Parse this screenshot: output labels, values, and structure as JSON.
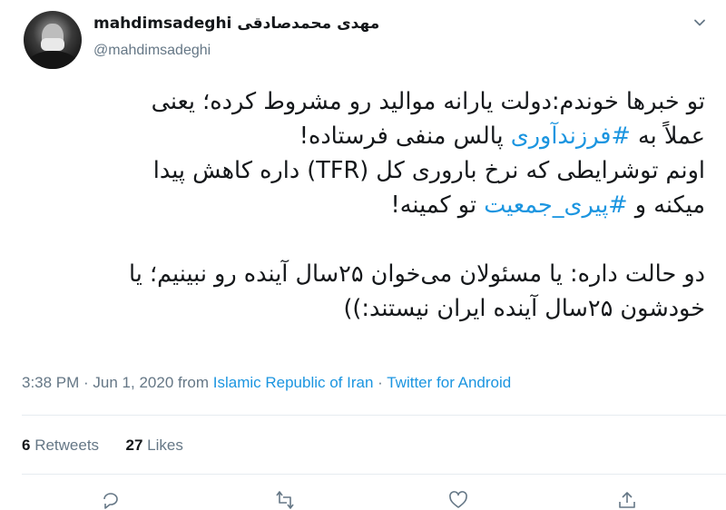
{
  "user": {
    "display_name": "mahdimsadeghi مهدی محمدصادقی",
    "handle": "@mahdimsadeghi"
  },
  "tweet": {
    "lines": [
      [
        {
          "text": "تو خبرها خوندم:دولت یارانه موالید رو مشروط کرده؛ یعنی"
        }
      ],
      [
        {
          "text": "عملاً به "
        },
        {
          "text": "#فرزندآوری",
          "hashtag": true
        },
        {
          "text": " پالس منفی فرستاده!"
        }
      ],
      [
        {
          "text": "اونم توشرایطی که نرخ باروری کل (TFR) داره کاهش پیدا"
        }
      ],
      [
        {
          "text": "میکنه و "
        },
        {
          "text": "#پیری_جمعیت",
          "hashtag": true
        },
        {
          "text": " تو کمینه!"
        }
      ],
      [],
      [
        {
          "text": "دو حالت داره: یا مسئولان می‌خوان ۲۵سال آینده رو نبینیم؛ یا"
        }
      ],
      [
        {
          "text": "خودشون ۲۵سال آینده ایران نیستند:))"
        }
      ]
    ]
  },
  "meta": {
    "time": "3:38 PM",
    "separator1": " · ",
    "date": "Jun 1, 2020",
    "from_label": " from ",
    "location": "Islamic Republic of Iran",
    "separator2": " · ",
    "source": "Twitter for Android"
  },
  "stats": {
    "retweets_count": "6",
    "retweets_label": " Retweets",
    "likes_count": "27",
    "likes_label": " Likes"
  },
  "icons": {
    "caret": "chevron-down-icon",
    "reply": "reply-icon",
    "retweet": "retweet-icon",
    "like": "heart-icon",
    "share": "share-icon"
  },
  "colors": {
    "text": "#14171a",
    "secondary": "#657786",
    "link": "#1b95e0",
    "divider": "#e6ecf0"
  }
}
